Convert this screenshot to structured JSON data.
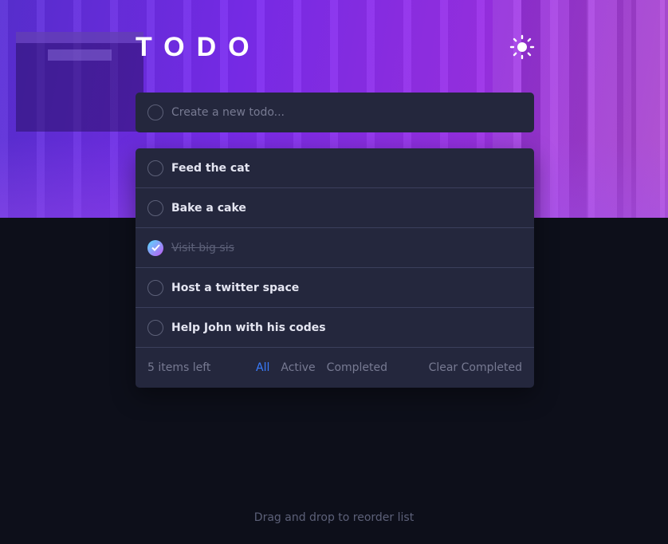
{
  "header": {
    "title": "TODO",
    "theme_icon": "sun-icon"
  },
  "new_todo": {
    "placeholder": "Create a new todo..."
  },
  "todos": [
    {
      "text": "Feed the cat",
      "completed": false
    },
    {
      "text": "Bake a cake",
      "completed": false
    },
    {
      "text": "Visit big sis",
      "completed": true
    },
    {
      "text": "Host a twitter space",
      "completed": false
    },
    {
      "text": "Help John with his codes",
      "completed": false
    }
  ],
  "footer": {
    "items_left": "5 items left",
    "filters": [
      "All",
      "Active",
      "Completed"
    ],
    "active_filter": "All",
    "clear_label": "Clear Completed"
  },
  "hint": "Drag and drop to reorder list",
  "colors": {
    "accent": "#3a7cfd",
    "check_gradient_start": "#57ddff",
    "check_gradient_end": "#c058f3",
    "card": "#24273d",
    "background": "#0d0f1a"
  }
}
